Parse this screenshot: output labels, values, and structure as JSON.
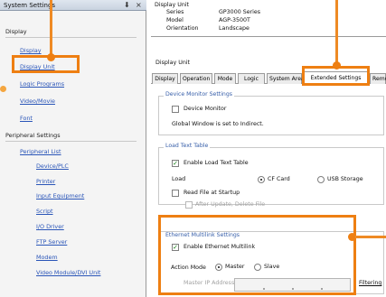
{
  "left_pane": {
    "title": "System Settings",
    "pin_glyph": "⬇",
    "close_glyph": "×",
    "display_heading": "Display",
    "display_items": [
      "Display",
      "Display Unit",
      "Logic Programs",
      "Video/Movie",
      "Font"
    ],
    "peripheral_heading": "Peripheral Settings",
    "peripheral_items": [
      "Peripheral List",
      "Device/PLC",
      "Printer",
      "Input Equipment",
      "Script",
      "I/O Driver",
      "FTP Server",
      "Modem",
      "Video Module/DVI Unit"
    ]
  },
  "display_unit": {
    "section_title": "Display Unit",
    "series_label": "Series",
    "series_value": "GP3000 Series",
    "model_label": "Model",
    "model_value": "AGP-3500T",
    "orientation_label": "Orientation",
    "orientation_value": "Landscape"
  },
  "tabs": {
    "group_title": "Display Unit",
    "items": [
      "Display",
      "Operation",
      "Mode",
      "Logic",
      "System Area",
      "Extended Settings",
      "Remo"
    ],
    "active_index": 5
  },
  "device_monitor": {
    "title": "Device Monitor Settings",
    "checkbox_label": "Device Monitor",
    "checked": false,
    "note": "Global Window is set to Indirect."
  },
  "load_text": {
    "title": "Load Text Table",
    "enable_label": "Enable Load Text Table",
    "enable_checked": true,
    "load_label": "Load",
    "option_cf": "CF Card",
    "option_usb": "USB Storage",
    "selected_option": "CF Card",
    "read_startup_label": "Read File at Startup",
    "read_startup_checked": false,
    "after_update_label": "After Update, Delete File",
    "after_update_checked": false
  },
  "multilink": {
    "title": "Ethernet Multilink Settings",
    "enable_label": "Enable Ethernet Multilink",
    "enable_checked": true,
    "action_mode_label": "Action Mode",
    "option_master": "Master",
    "option_slave": "Slave",
    "selected_mode": "Master",
    "master_ip_label": "Master IP Address",
    "filtering_link": "Filtering"
  },
  "colors": {
    "callout": "#ee7f12",
    "link": "#2a55b8",
    "section_title": "#355da8"
  }
}
